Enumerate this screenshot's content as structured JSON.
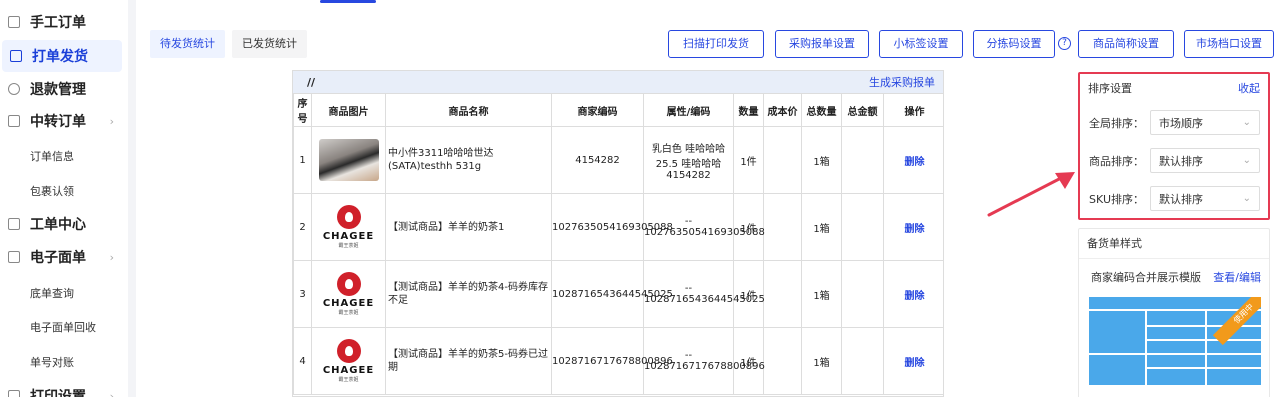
{
  "sidebar": {
    "items": [
      {
        "label": "手工订单",
        "icon": "edit-icon"
      },
      {
        "label": "打单发货",
        "icon": "truck-icon",
        "active": true
      },
      {
        "label": "退款管理",
        "icon": "refund-icon"
      },
      {
        "label": "中转订单",
        "icon": "home-icon",
        "chevron": "›"
      },
      {
        "label": "工单中心",
        "icon": "list-icon"
      },
      {
        "label": "电子面单",
        "icon": "doc-icon",
        "chevron": "›"
      },
      {
        "label": "打印设置",
        "icon": "printer-icon",
        "chevron": "›"
      }
    ],
    "subs": {
      "transfer": [
        "订单信息",
        "包裹认领"
      ],
      "eform": [
        "底单查询",
        "电子面单回收",
        "单号对账"
      ]
    }
  },
  "subtabs": {
    "pending": "待发货统计",
    "shipped": "已发货统计"
  },
  "toolbar": {
    "buttons": [
      "扫描打印发货",
      "采购报单设置",
      "小标签设置",
      "分拣码设置",
      "商品简称设置",
      "市场档口设置"
    ],
    "help": "?"
  },
  "table": {
    "bar_left": "//",
    "bar_right": "生成采购报单",
    "headers": [
      "序号",
      "商品图片",
      "商品名称",
      "商家编码",
      "属性/编码",
      "数量",
      "成本价",
      "总数量",
      "总金额",
      "操作"
    ],
    "rows": [
      {
        "no": "1",
        "image": "shoe",
        "name": "中小件3311哈哈哈世达(SATA)testhh 531g",
        "code": "4154282",
        "attr": "乳白色 哇哈哈哈 25.5 哇哈哈哈 4154282",
        "qty": "1件",
        "cost": "",
        "total": "1箱",
        "amount": "",
        "action": "删除"
      },
      {
        "no": "2",
        "image": "chagee",
        "name": "【测试商品】羊羊的奶茶1",
        "code": "1027635054169305088",
        "attr": "-- 1027635054169305088",
        "qty": "1件",
        "cost": "",
        "total": "1箱",
        "amount": "",
        "action": "删除"
      },
      {
        "no": "3",
        "image": "chagee",
        "name": "【测试商品】羊羊的奶茶4-码券库存不足",
        "code": "1028716543644545025",
        "attr": "-- 1028716543644545025",
        "qty": "1件",
        "cost": "",
        "total": "1箱",
        "amount": "",
        "action": "删除"
      },
      {
        "no": "4",
        "image": "chagee",
        "name": "【测试商品】羊羊的奶茶5-码券已过期",
        "code": "1028716717678800896",
        "attr": "-- 1028716717678800896",
        "qty": "1件",
        "cost": "",
        "total": "1箱",
        "amount": "",
        "action": "删除"
      }
    ],
    "logo_word": "CHAGEE",
    "logo_sub": "霸王茶姬"
  },
  "sort": {
    "title": "排序设置",
    "collapse": "收起",
    "rows": [
      {
        "label": "全局排序：",
        "value": "市场顺序"
      },
      {
        "label": "商品排序：",
        "value": "默认排序"
      },
      {
        "label": "SKU排序：",
        "value": "默认排序"
      }
    ]
  },
  "stock": {
    "title": "备货单样式",
    "template_name": "商家编码合并展示模版",
    "edit": "查看/编辑",
    "badge": "使用中"
  },
  "colors": {
    "accent": "#2848e0",
    "highlight": "#e53a52",
    "template": "#4aa8ea",
    "badge": "#f29a1b"
  }
}
